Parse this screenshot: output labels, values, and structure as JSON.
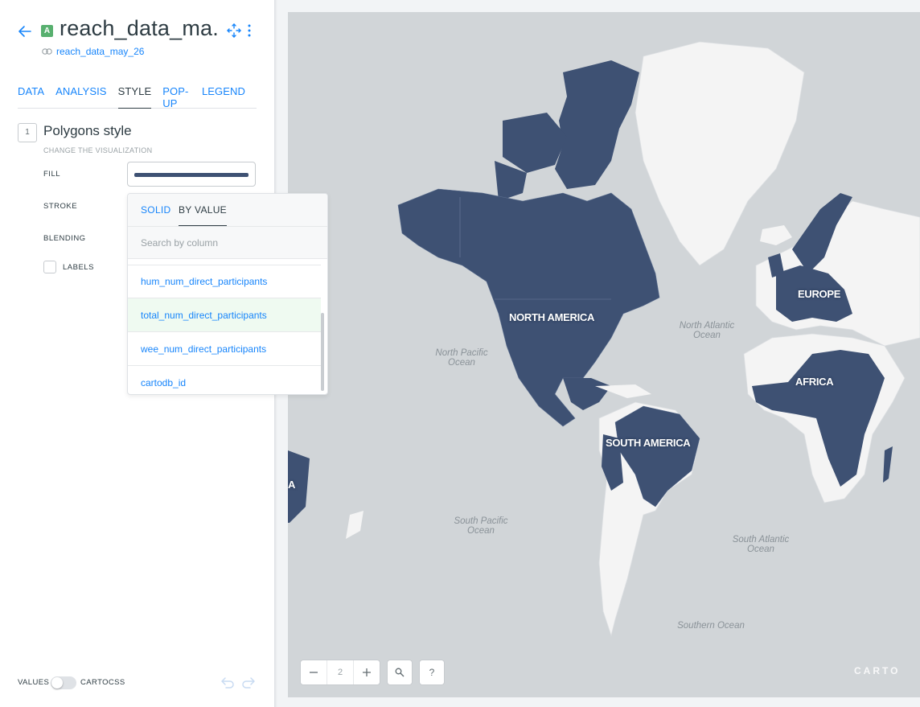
{
  "header": {
    "layer_badge": "A",
    "layer_title": "reach_data_ma..",
    "source_link": "reach_data_may_26"
  },
  "tabs": [
    {
      "label": "DATA"
    },
    {
      "label": "ANALYSIS"
    },
    {
      "label": "STYLE"
    },
    {
      "label": "POP-UP"
    },
    {
      "label": "LEGEND"
    }
  ],
  "style_section": {
    "step": "1",
    "title": "Polygons style",
    "subtitle": "CHANGE THE VISUALIZATION",
    "fill_label": "FILL",
    "stroke_label": "STROKE",
    "blending_label": "BLENDING",
    "labels_label": "LABELS",
    "fill_color": "#3e5173"
  },
  "dropdown": {
    "tab_solid": "SOLID",
    "tab_by_value": "BY VALUE",
    "search_placeholder": "Search by column",
    "columns": [
      "hum_num_direct_participants",
      "total_num_direct_participants",
      "wee_num_direct_participants",
      "cartodb_id"
    ]
  },
  "footer": {
    "values_label": "VALUES",
    "cartocss_label": "CARTOCSS"
  },
  "map": {
    "continents": {
      "north_america": "NORTH AMERICA",
      "south_america": "SOUTH AMERICA",
      "europe": "EUROPE",
      "africa": "AFRICA",
      "partial": "A"
    },
    "oceans": {
      "north_pacific": "North Pacific Ocean",
      "south_pacific": "South Pacific Ocean",
      "north_atlantic": "North Atlantic Ocean",
      "south_atlantic": "South Atlantic Ocean",
      "southern": "Southern Ocean"
    },
    "zoom_level": "2",
    "logo": "CARTO",
    "colors": {
      "water": "#d1d5d8",
      "land": "#f4f4f4",
      "highlight": "#3e5173"
    }
  }
}
